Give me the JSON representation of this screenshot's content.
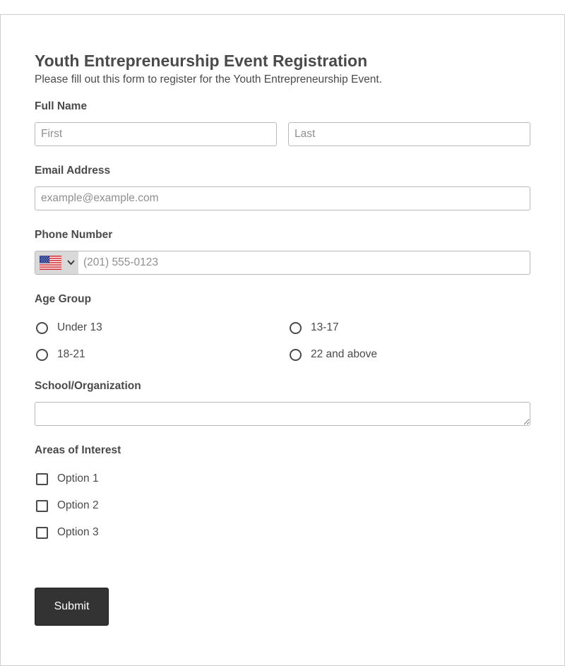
{
  "form": {
    "title": "Youth Entrepreneurship Event Registration",
    "subtitle": "Please fill out this form to register for the Youth Entrepreneurship Event."
  },
  "full_name": {
    "label": "Full Name",
    "first_placeholder": "First",
    "last_placeholder": "Last"
  },
  "email": {
    "label": "Email Address",
    "placeholder": "example@example.com"
  },
  "phone": {
    "label": "Phone Number",
    "country_icon": "us-flag-icon",
    "placeholder": "(201) 555-0123"
  },
  "age_group": {
    "label": "Age Group",
    "options": [
      "Under 13",
      "13-17",
      "18-21",
      "22 and above"
    ]
  },
  "school": {
    "label": "School/Organization",
    "value": ""
  },
  "interests": {
    "label": "Areas of Interest",
    "options": [
      "Option 1",
      "Option 2",
      "Option 3"
    ]
  },
  "submit": {
    "label": "Submit"
  },
  "colors": {
    "text": "#4a4a4a",
    "border": "#b8b8b8",
    "button_bg": "#333333",
    "button_text": "#ffffff",
    "country_bg": "#d9d9d9"
  }
}
